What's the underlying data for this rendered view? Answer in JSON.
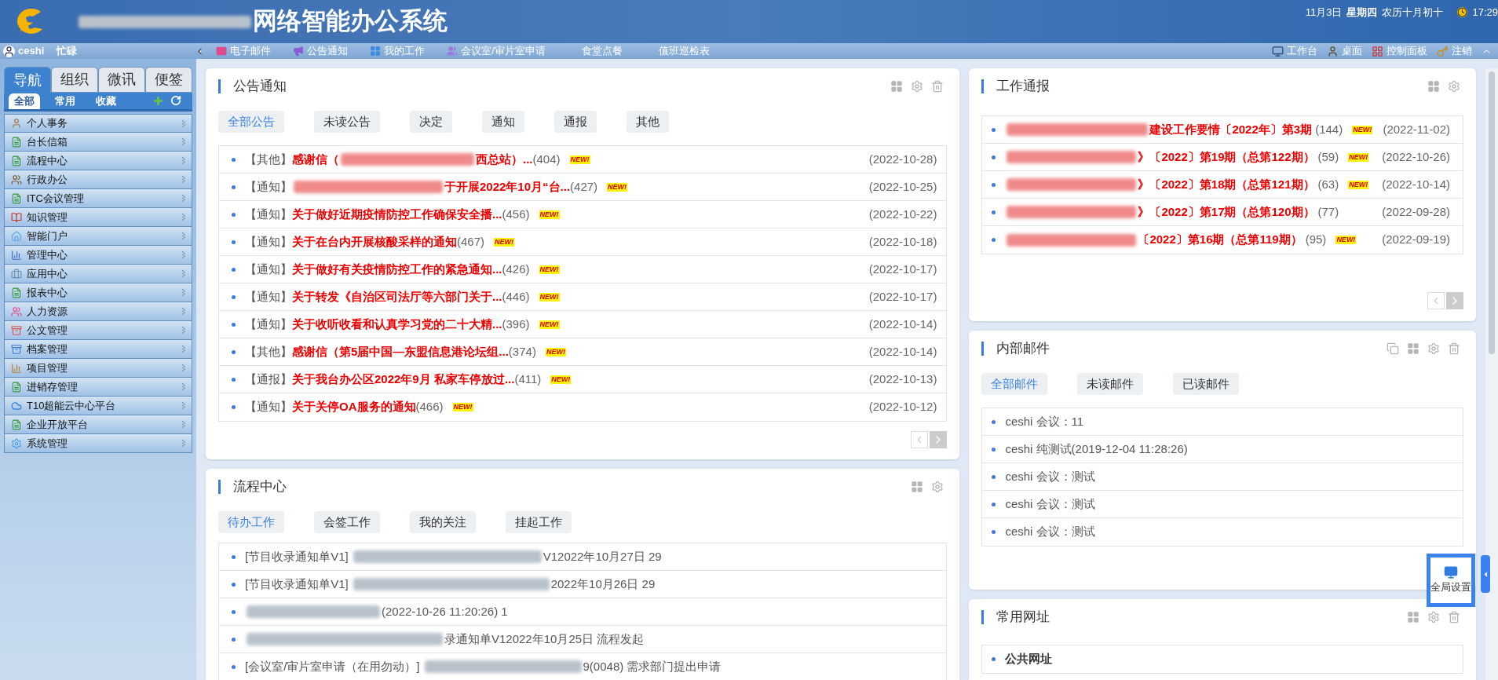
{
  "header": {
    "title": "网络智能办公系统",
    "title_redacted": true,
    "date": "11月3日",
    "weekday": "星期四",
    "lunar": "农历十月初十",
    "time": "17:29"
  },
  "toolbar": {
    "user": "ceshi",
    "status": "忙碌",
    "left_items": [
      {
        "label": "电子邮件"
      },
      {
        "label": "公告通知"
      },
      {
        "label": "我的工作"
      },
      {
        "label": "会议室/审片室申请"
      },
      {
        "label": "食堂点餐"
      },
      {
        "label": "值班巡检表"
      }
    ],
    "right_items": [
      {
        "label": "工作台"
      },
      {
        "label": "桌面"
      },
      {
        "label": "控制面板"
      },
      {
        "label": "注销"
      }
    ]
  },
  "sidebar": {
    "tabs": [
      {
        "label": "导航",
        "selected": true
      },
      {
        "label": "组织",
        "selected": false
      },
      {
        "label": "微讯",
        "selected": false
      },
      {
        "label": "便签",
        "selected": false
      }
    ],
    "subtabs": [
      {
        "label": "全部",
        "selected": true
      },
      {
        "label": "常用",
        "selected": false
      },
      {
        "label": "收藏",
        "selected": false
      }
    ],
    "items": [
      {
        "label": "个人事务"
      },
      {
        "label": "台长信箱"
      },
      {
        "label": "流程中心"
      },
      {
        "label": "行政办公"
      },
      {
        "label": "ITC会议管理"
      },
      {
        "label": "知识管理"
      },
      {
        "label": "智能门户"
      },
      {
        "label": "管理中心"
      },
      {
        "label": "应用中心"
      },
      {
        "label": "报表中心"
      },
      {
        "label": "人力资源"
      },
      {
        "label": "公文管理"
      },
      {
        "label": "档案管理"
      },
      {
        "label": "项目管理"
      },
      {
        "label": "进销存管理"
      },
      {
        "label": "T10超能云中心平台"
      },
      {
        "label": "企业开放平台"
      },
      {
        "label": "系统管理"
      }
    ]
  },
  "announcements": {
    "title": "公告通知",
    "tabs": [
      {
        "label": "全部公告",
        "selected": true
      },
      {
        "label": "未读公告",
        "selected": false
      },
      {
        "label": "决定",
        "selected": false
      },
      {
        "label": "通知",
        "selected": false
      },
      {
        "label": "通报",
        "selected": false
      },
      {
        "label": "其他",
        "selected": false
      }
    ],
    "rows": [
      {
        "tag": "【其他】",
        "before": "感谢信（",
        "redacted": true,
        "after": "西总站）...",
        "count": "(404)",
        "badge": "NEW!",
        "date": "(2022-10-28)"
      },
      {
        "tag": "【通知】",
        "before": "",
        "redacted": true,
        "after": "于开展2022年10月“台...",
        "count": "(427)",
        "badge": "NEW!",
        "date": "(2022-10-25)"
      },
      {
        "tag": "【通知】",
        "before": "关于做好近期疫情防控工作确保安全播...",
        "redacted": false,
        "after": "",
        "count": "(456)",
        "badge": "NEW!",
        "date": "(2022-10-22)"
      },
      {
        "tag": "【通知】",
        "before": "关于在台内开展核酸采样的通知",
        "redacted": false,
        "after": "",
        "count": "(467)",
        "badge": "NEW!",
        "date": "(2022-10-18)"
      },
      {
        "tag": "【通知】",
        "before": "关于做好有关疫情防控工作的紧急通知...",
        "redacted": false,
        "after": "",
        "count": "(426)",
        "badge": "NEW!",
        "date": "(2022-10-17)"
      },
      {
        "tag": "【通知】",
        "before": "关于转发《自治区司法厅等六部门关于...",
        "redacted": false,
        "after": "",
        "count": "(446)",
        "badge": "NEW!",
        "date": "(2022-10-17)"
      },
      {
        "tag": "【通知】",
        "before": "关于收听收看和认真学习党的二十大精...",
        "redacted": false,
        "after": "",
        "count": "(396)",
        "badge": "NEW!",
        "date": "(2022-10-14)"
      },
      {
        "tag": "【其他】",
        "before": "感谢信（第5届中国—东盟信息港论坛组...",
        "redacted": false,
        "after": "",
        "count": "(374)",
        "badge": "NEW!",
        "date": "(2022-10-14)"
      },
      {
        "tag": "【通报】",
        "before": "关于我台办公区2022年9月 私家车停放过...",
        "redacted": false,
        "after": "",
        "count": "(411)",
        "badge": "NEW!",
        "date": "(2022-10-13)"
      },
      {
        "tag": "【通知】",
        "before": "关于关停OA服务的通知",
        "redacted": false,
        "after": "",
        "count": "(466)",
        "badge": "NEW!",
        "date": "(2022-10-12)"
      }
    ]
  },
  "workflow": {
    "title": "流程中心",
    "tabs": [
      {
        "label": "待办工作",
        "selected": true
      },
      {
        "label": "会签工作",
        "selected": false
      },
      {
        "label": "我的关注",
        "selected": false
      },
      {
        "label": "挂起工作",
        "selected": false
      }
    ],
    "rows": [
      {
        "before": "[节目收录通知单V1]",
        "after": "V12022年10月27日 29"
      },
      {
        "before": "[节目收录通知单V1]",
        "after": "2022年10月26日 29"
      },
      {
        "before": "",
        "after": "(2022-10-26 11:20:26) 1"
      },
      {
        "before": "",
        "after": "录通知单V12022年10月25日 流程发起"
      },
      {
        "before": "[会议室/审片室申请（在用勿动）]",
        "after": "9(0048) 需求部门提出申请"
      }
    ]
  },
  "work_reports": {
    "title": "工作通报",
    "rows": [
      {
        "after": "建设工作要情〔2022年〕第3期",
        "count": "(144)",
        "badge": "NEW!",
        "date": "(2022-11-02)"
      },
      {
        "after": "》〔2022〕第19期（总第122期）",
        "count": "(59)",
        "badge": "NEW!",
        "date": "(2022-10-26)"
      },
      {
        "after": "》〔2022〕第18期（总第121期）",
        "count": "(63)",
        "badge": "NEW!",
        "date": "(2022-10-14)"
      },
      {
        "after": "》〔2022〕第17期（总第120期）",
        "count": "(77)",
        "date": "(2022-09-28)"
      },
      {
        "after": "〔2022〕第16期（总第119期）",
        "count": "(95)",
        "badge": "NEW!",
        "date": "(2022-09-19)"
      }
    ]
  },
  "mail": {
    "title": "内部邮件",
    "tabs": [
      {
        "label": "全部邮件",
        "selected": true
      },
      {
        "label": "未读邮件",
        "selected": false
      },
      {
        "label": "已读邮件",
        "selected": false
      }
    ],
    "rows": [
      {
        "text": "ceshi 会议：11"
      },
      {
        "text": "ceshi 纯测试(2019-12-04 11:28:26)"
      },
      {
        "text": "ceshi 会议：测试"
      },
      {
        "text": "ceshi 会议：测试"
      },
      {
        "text": "ceshi 会议：测试"
      }
    ]
  },
  "global_settings": {
    "label": "全局设置"
  },
  "links": {
    "title": "常用网址",
    "rows": [
      {
        "text": "公共网址"
      }
    ]
  }
}
